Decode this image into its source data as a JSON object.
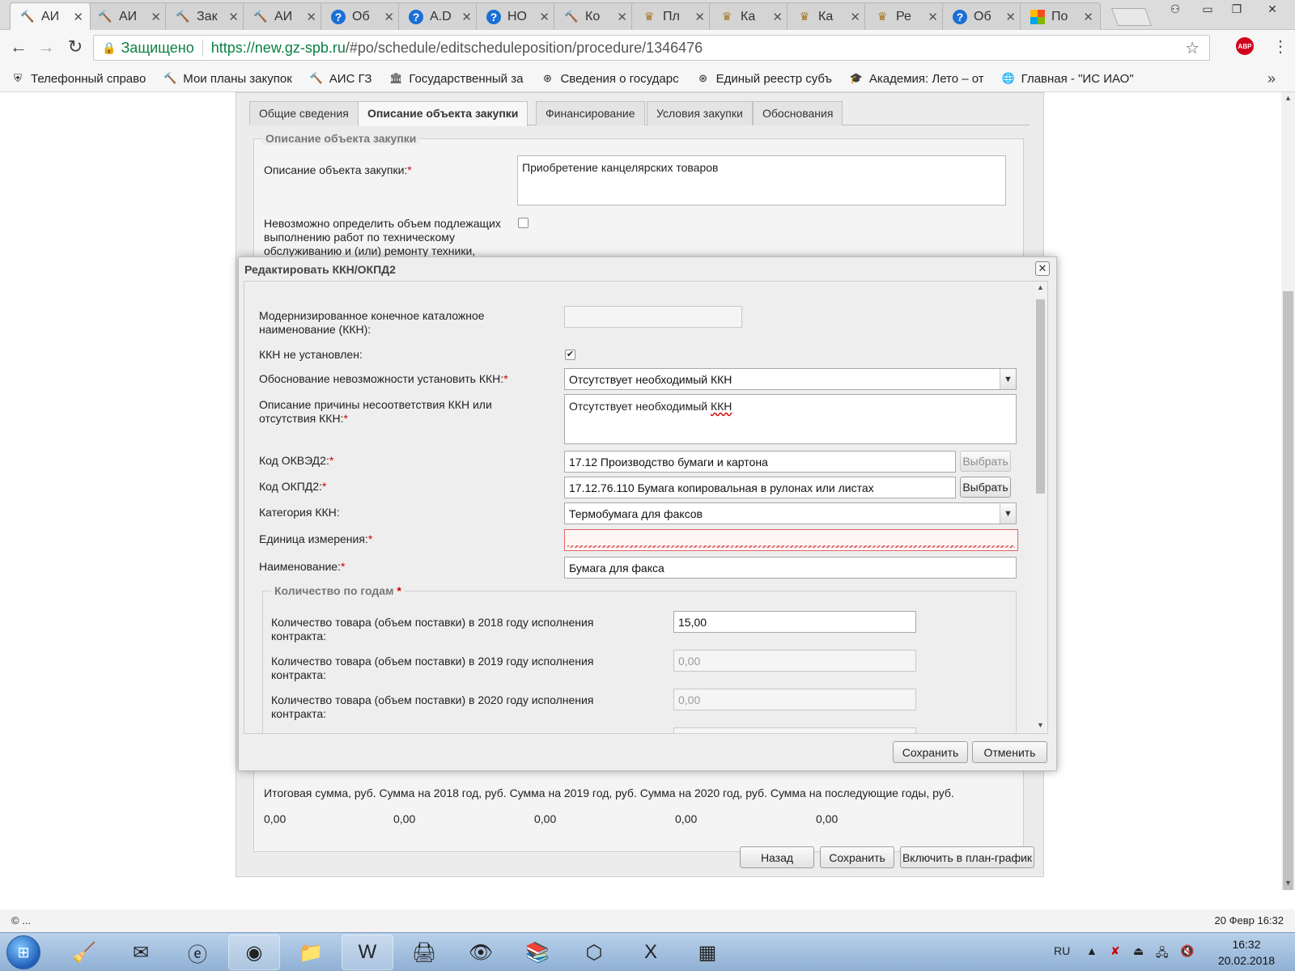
{
  "browser": {
    "tabs": [
      {
        "title": "АИ",
        "icon": "tool-icon",
        "active": true
      },
      {
        "title": "АИ",
        "icon": "tool-icon"
      },
      {
        "title": "Зак",
        "icon": "tool-icon"
      },
      {
        "title": "АИ",
        "icon": "tool-icon"
      },
      {
        "title": "Об",
        "icon": "help-icon"
      },
      {
        "title": "A.D",
        "icon": "help-icon"
      },
      {
        "title": "НО",
        "icon": "help-icon"
      },
      {
        "title": "Ко",
        "icon": "tool-icon"
      },
      {
        "title": "Пл",
        "icon": "eagle-icon"
      },
      {
        "title": "Ка",
        "icon": "eagle-icon"
      },
      {
        "title": "Ка",
        "icon": "eagle-icon"
      },
      {
        "title": "Ре",
        "icon": "eagle-icon"
      },
      {
        "title": "Об",
        "icon": "help-icon"
      },
      {
        "title": "По",
        "icon": "windows-icon"
      }
    ],
    "secure_label": "Защищено",
    "url_host": "https://new.gz-spb.ru",
    "url_path": "/#po/schedule/editscheduleposition/procedure/1346476",
    "abp_label": "ABP",
    "bookmarks": [
      {
        "label": "Телефонный справо",
        "icon": "spb-icon"
      },
      {
        "label": "Мои планы закупок",
        "icon": "tool-icon"
      },
      {
        "label": "АИС ГЗ",
        "icon": "tool-icon"
      },
      {
        "label": "Государственный за",
        "icon": "building-icon"
      },
      {
        "label": "Сведения о государс",
        "icon": "seal-icon"
      },
      {
        "label": "Единый реестр субъ",
        "icon": "seal-icon"
      },
      {
        "label": "Академия: Лето – от",
        "icon": "graduation-icon"
      },
      {
        "label": "Главная - \"ИС ИАО\"",
        "icon": "globe-icon"
      }
    ],
    "more_label": "»"
  },
  "page": {
    "tabs": [
      "Общие сведения",
      "Описание объекта закупки",
      "Финансирование",
      "Условия закупки",
      "Обоснования"
    ],
    "section_legend": "Описание объекта закупки",
    "description_label": "Описание объекта закупки:",
    "description_value": "Приобретение канцелярских товаров",
    "cannot_determine_label": "Невозможно определить объем подлежащих выполнению работ по техническому обслуживанию и (или) ремонту техники,",
    "totals_header": "Итоговая сумма, руб. Сумма на 2018 год, руб. Сумма на 2019 год, руб. Сумма на 2020 год, руб. Сумма на последующие годы, руб.",
    "totals_values": [
      "0,00",
      "0,00",
      "0,00",
      "0,00",
      "0,00"
    ],
    "back_button": "Назад",
    "save_button": "Сохранить",
    "include_button": "Включить в план-график"
  },
  "modal": {
    "title": "Редактировать ККН/ОКПД2",
    "close_glyph": "✕",
    "kkn_label": "Модернизированное конечное каталожное наименование (ККН):",
    "kkn_value": "",
    "kkn_not_set_label": "ККН не установлен:",
    "kkn_not_set_checked": true,
    "reason_label": "Обоснование невозможности установить ККН:",
    "reason_value": "Отсутствует необходимый ККН",
    "reason_desc_label": "Описание причины несоответствия ККН или отсутствия ККН:",
    "reason_desc_value_1": "Отсутствует необходимый ",
    "reason_desc_value_2": "ККН",
    "okved_label": "Код ОКВЭД2:",
    "okved_value": "17.12 Производство бумаги и картона",
    "okpd_label": "Код ОКПД2:",
    "okpd_value": "17.12.76.110 Бумага копировальная в рулонах или листах",
    "select_button": "Выбрать",
    "category_label": "Категория ККН:",
    "category_value": "Термобумага для факсов",
    "unit_label": "Единица измерения:",
    "unit_value": "",
    "name_label": "Наименование:",
    "name_value": "Бумага для факса",
    "qty_legend": "Количество по годам",
    "qty_rows": [
      {
        "label": "Количество товара (объем поставки) в 2018 году исполнения контракта:",
        "value": "15,00",
        "disabled": false
      },
      {
        "label": "Количество товара (объем поставки) в 2019 году исполнения контракта:",
        "value": "0,00",
        "disabled": true
      },
      {
        "label": "Количество товара (объем поставки) в 2020 году исполнения контракта:",
        "value": "0,00",
        "disabled": true
      }
    ],
    "save_button": "Сохранить",
    "cancel_button": "Отменить",
    "required_mark": "*"
  },
  "status": {
    "left": "© ...",
    "right": "20 Февр 16:32"
  },
  "taskbar": {
    "lang": "RU",
    "time": "16:32",
    "date": "20.02.2018"
  }
}
